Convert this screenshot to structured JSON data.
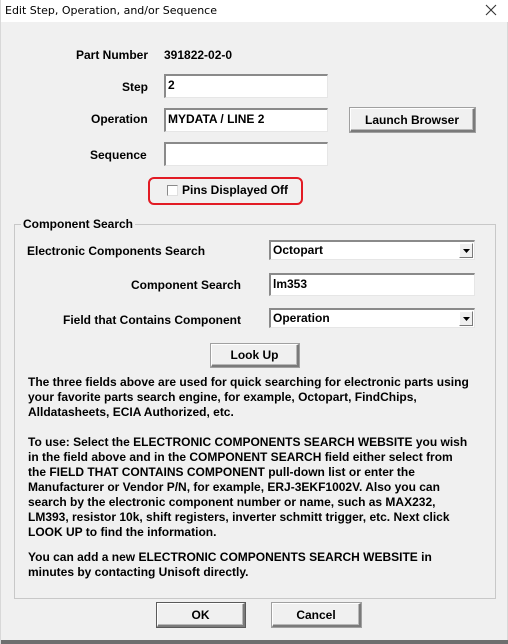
{
  "window": {
    "title": "Edit Step, Operation, and/or Sequence",
    "close_icon": "close-icon"
  },
  "form": {
    "part_number_label": "Part Number",
    "part_number_value": "391822-02-0",
    "step_label": "Step",
    "step_value": "2",
    "operation_label": "Operation",
    "operation_value": "MYDATA / LINE 2",
    "sequence_label": "Sequence",
    "sequence_value": "",
    "launch_browser_label": "Launch Browser",
    "pins_displayed_label": "Pins Displayed Off",
    "pins_displayed_checked": false,
    "highlight_color": "#e21b24"
  },
  "component_search": {
    "group_title": "Component Search",
    "electronic_search_label": "Electronic Components Search",
    "electronic_search_value": "Octopart",
    "component_search_label": "Component Search",
    "component_search_value": "lm353",
    "field_contains_label": "Field that Contains Component",
    "field_contains_value": "Operation",
    "lookup_label": "Look Up",
    "help_paragraphs": [
      "The three fields above are used for quick searching for electronic parts using\nyour favorite parts search engine, for example, Octopart, FindChips,\nAlldatasheets, ECIA Authorized, etc.",
      "To use: Select the ELECTRONIC COMPONENTS SEARCH WEBSITE you wish\nin the field above and in the COMPONENT SEARCH field either select from\nthe FIELD THAT CONTAINS COMPONENT pull-down list or enter the\nManufacturer or Vendor P/N, for example, ERJ-3EKF1002V.  Also you can\nsearch by the electronic component number or name, such as MAX232,\nLM393, resistor 10k, shift registers, inverter schmitt trigger, etc.  Next click\nLOOK UP to find the information.",
      "You can add a new ELECTRONIC COMPONENTS SEARCH WEBSITE in\nminutes by contacting Unisoft directly."
    ]
  },
  "footer": {
    "ok_label": "OK",
    "cancel_label": "Cancel"
  }
}
